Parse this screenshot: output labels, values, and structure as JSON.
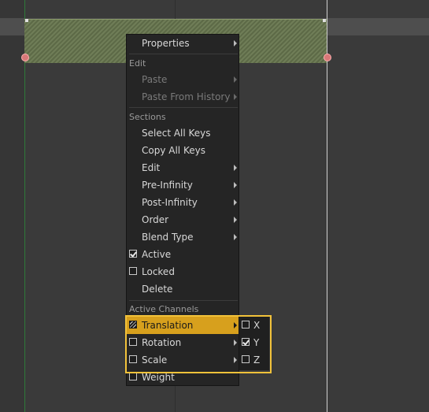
{
  "menu": {
    "properties": "Properties",
    "edit_header": "Edit",
    "paste": "Paste",
    "paste_from_history": "Paste From History",
    "sections_header": "Sections",
    "select_all_keys": "Select All Keys",
    "copy_all_keys": "Copy All Keys",
    "edit": "Edit",
    "pre_infinity": "Pre-Infinity",
    "post_infinity": "Post-Infinity",
    "order": "Order",
    "blend_type": "Blend Type",
    "active": "Active",
    "locked": "Locked",
    "delete": "Delete",
    "active_channels_header": "Active Channels",
    "translation": "Translation",
    "rotation": "Rotation",
    "scale": "Scale",
    "weight": "Weight"
  },
  "submenu": {
    "x": "X",
    "y": "Y",
    "z": "Z"
  },
  "state": {
    "active": true,
    "locked": false,
    "translation": "partial",
    "rotation": false,
    "scale": false,
    "weight": false,
    "x": false,
    "y": true,
    "z": false
  },
  "colors": {
    "highlight": "#d7a01d",
    "submenu_border": "#f2c23a",
    "section_bar": "#6f7d57"
  }
}
